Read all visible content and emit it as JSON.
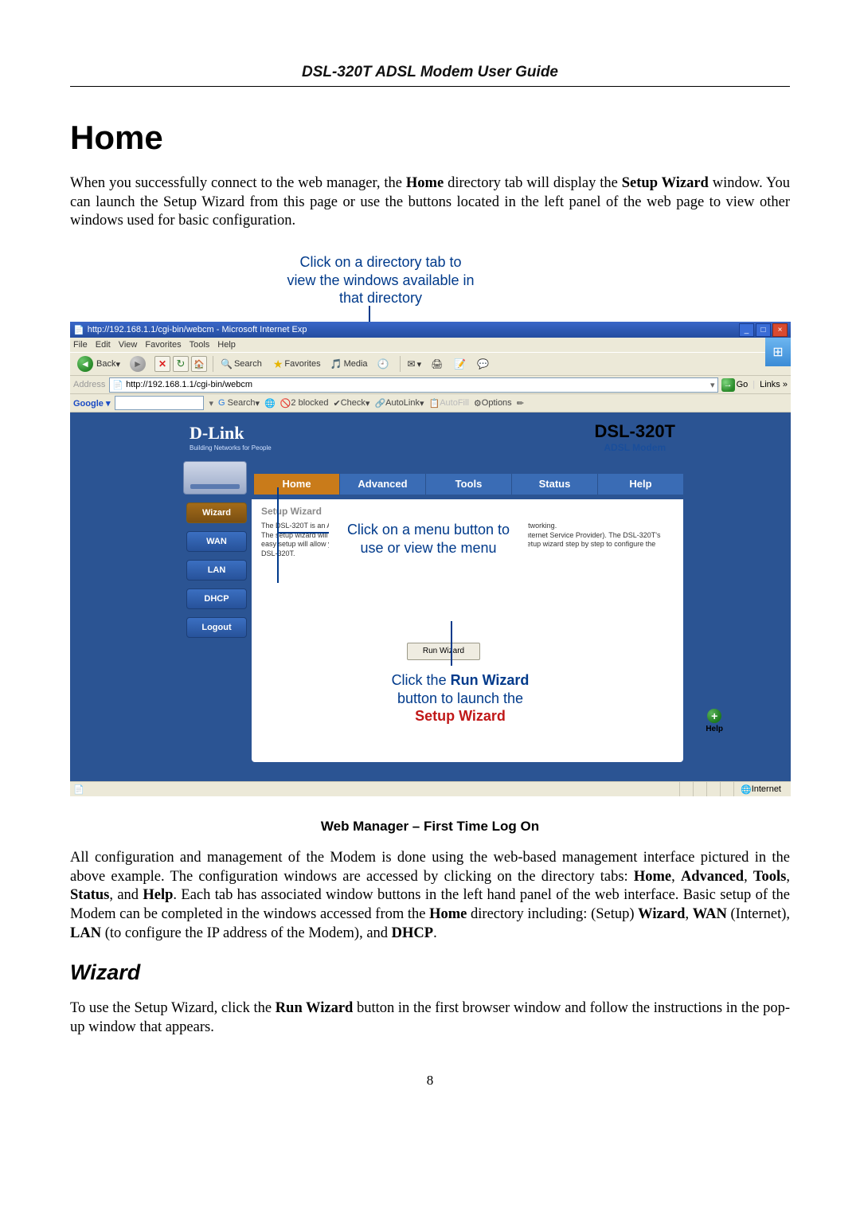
{
  "header": "DSL-320T ADSL Modem User Guide",
  "h1": "Home",
  "intro": "When you successfully connect to the web manager, the Home directory tab will display the Setup Wizard window. You can launch the Setup Wizard from this page or use the buttons located in the left panel of the web page to view other windows used for basic configuration.",
  "callouts": {
    "top": "Click on a directory tab to view the windows available in that directory",
    "mid": "Click on a menu button to use or view the menu",
    "bot1": "Click the ",
    "bot_run": "Run Wizard",
    "bot2": " button to launch the ",
    "bot_setup": "Setup Wizard"
  },
  "ie": {
    "title": "http://192.168.1.1/cgi-bin/webcm - Microsoft Internet Exp",
    "menu": {
      "file": "File",
      "edit": "Edit",
      "view": "View",
      "favorites": "Favorites",
      "tools": "Tools",
      "help": "Help"
    },
    "toolbar": {
      "back": "Back",
      "search": "Search",
      "favorites": "Favorites",
      "media": "Media"
    },
    "address_label": "Address",
    "address_value": "http://192.168.1.1/cgi-bin/webcm",
    "go": "Go",
    "links": "Links",
    "google": {
      "label": "Google ▾",
      "search": "Search",
      "blocked": "2 blocked",
      "check": "Check",
      "autolink": "AutoLink",
      "autofill": "AutoFill",
      "options": "Options"
    },
    "status_internet": "Internet"
  },
  "web": {
    "brand": "D-Link",
    "brand_sub": "Building Networks for People",
    "model": "DSL-320T",
    "model_sub": "ADSL Modem",
    "tabs": {
      "home": "Home",
      "advanced": "Advanced",
      "tools": "Tools",
      "status": "Status",
      "help": "Help"
    },
    "side": {
      "wizard": "Wizard",
      "wan": "WAN",
      "lan": "LAN",
      "dhcp": "DHCP",
      "logout": "Logout"
    },
    "panel_title": "Setup Wizard",
    "panel_text_l1": "The DSL-320T is an ADSL Modem ideal for home networking and small business networking.",
    "panel_text_l2": "The setup wizard will guide you to configure the DSL-320T to connect to your ISP (Internet Service Provider). The DSL-320T's easy setup will allow you to have Internet access within minutes. Please follow the setup wizard step by step to configure the DSL-320T.",
    "run_wizard": "Run Wizard",
    "help": "Help"
  },
  "caption": "Web Manager – First Time Log On",
  "para2_a": "All configuration and management of the Modem is done using the web-based management interface pictured in the above example. The configuration windows are accessed by clicking on the directory tabs: ",
  "para2_b": ". Each tab has associated window buttons in the left hand panel of the web interface. Basic setup of the Modem can be completed in the windows accessed from the ",
  "para2_c": " directory including: (Setup) ",
  "para2_d": " (Internet), ",
  "para2_e": " (to configure the IP address of the Modem), and ",
  "bold": {
    "home": "Home",
    "advanced": "Advanced",
    "tools": "Tools",
    "status": "Status",
    "help": "Help",
    "wizard": "Wizard",
    "wan": "WAN",
    "lan": "LAN",
    "dhcp": "DHCP",
    "runwizard": "Run Wizard"
  },
  "h2": "Wizard",
  "para3": "To use the Setup Wizard, click the Run Wizard button in the first browser window and follow the instructions in the pop-up window that appears.",
  "pagenum": "8"
}
